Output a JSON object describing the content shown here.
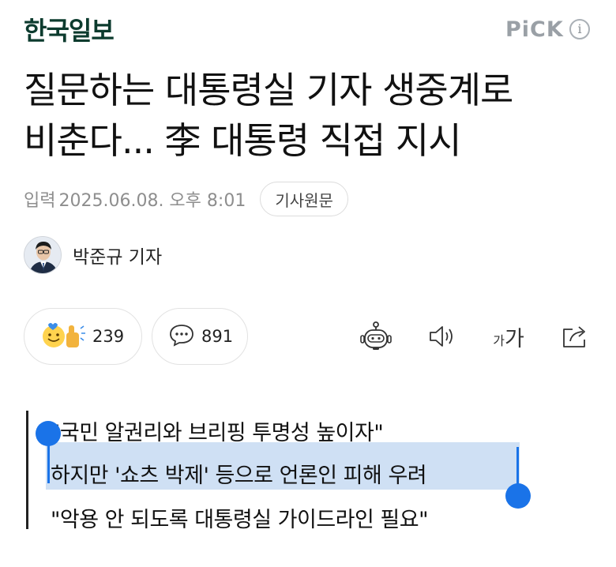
{
  "header": {
    "press_logo": "한국일보",
    "pick_label": "PiCK",
    "info_icon": "i"
  },
  "article": {
    "headline_line1": "질문하는 대통령실 기자 생중계로",
    "headline_line2": "비춘다... 李 대통령 직접 지시",
    "date_label": "입력",
    "date": "2025.06.08. 오후 8:01",
    "original_button": "기사원문",
    "reporter_name": "박준규 기자"
  },
  "actions": {
    "reaction_count": "239",
    "comment_count": "891",
    "icons": [
      "reaction-emoji-icon",
      "comment-icon",
      "ai-robot-icon",
      "speaker-icon",
      "font-size-icon",
      "share-icon"
    ],
    "font_size_small": "가",
    "font_size_large": "가"
  },
  "quote": {
    "line1": "\"국민 알권리와 브리핑 투명성 높이자\"",
    "line2": "하지만 '쇼츠 박제' 등으로 언론인 피해 우려",
    "line3": "\"악용 안 되도록 대통령실 가이드라인 필요\""
  },
  "colors": {
    "brand": "#0c3b2e",
    "selection": "#cfe0f4",
    "selection_handle": "#1a73e8",
    "muted": "#8e8e8e"
  }
}
